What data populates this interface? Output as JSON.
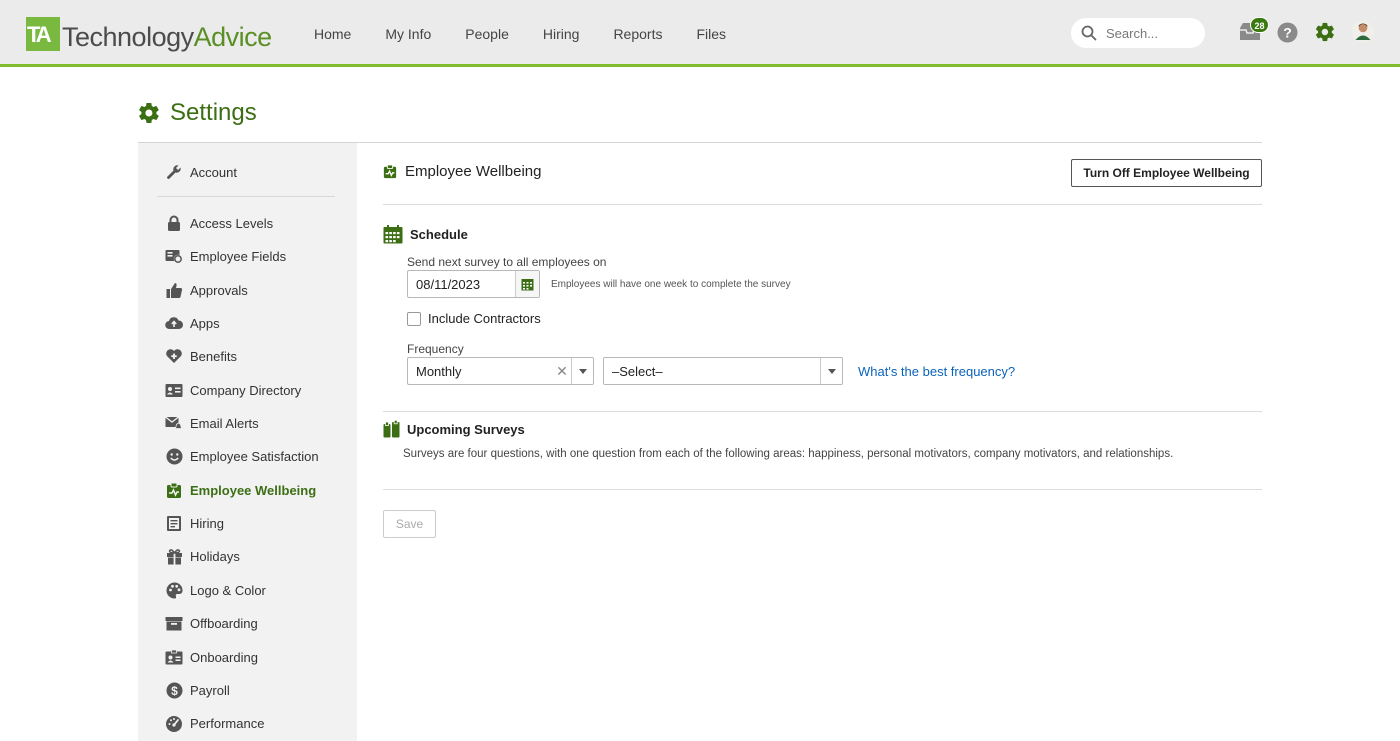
{
  "app": {
    "logo_mark": "TA",
    "logo_text_1": "Technology",
    "logo_text_2": "Advice"
  },
  "nav": {
    "items": [
      {
        "label": "Home"
      },
      {
        "label": "My Info"
      },
      {
        "label": "People"
      },
      {
        "label": "Hiring"
      },
      {
        "label": "Reports"
      },
      {
        "label": "Files"
      }
    ]
  },
  "header": {
    "search_placeholder": "Search...",
    "inbox_count": "28",
    "icons": [
      "inbox-icon",
      "help-icon",
      "settings-gear-icon",
      "user-avatar"
    ]
  },
  "page": {
    "title": "Settings"
  },
  "sidebar": {
    "items": [
      {
        "label": "Account",
        "icon": "wrench-icon"
      },
      {
        "label": "Access Levels",
        "icon": "lock-icon"
      },
      {
        "label": "Employee Fields",
        "icon": "id-card-icon"
      },
      {
        "label": "Approvals",
        "icon": "thumbs-up-icon"
      },
      {
        "label": "Apps",
        "icon": "cloud-upload-icon"
      },
      {
        "label": "Benefits",
        "icon": "heart-plus-icon"
      },
      {
        "label": "Company Directory",
        "icon": "address-book-icon"
      },
      {
        "label": "Email Alerts",
        "icon": "mail-alert-icon"
      },
      {
        "label": "Employee Satisfaction",
        "icon": "smiley-icon"
      },
      {
        "label": "Employee Wellbeing",
        "icon": "wellbeing-icon",
        "active": true
      },
      {
        "label": "Hiring",
        "icon": "clipboard-icon"
      },
      {
        "label": "Holidays",
        "icon": "gift-icon"
      },
      {
        "label": "Logo & Color",
        "icon": "palette-icon"
      },
      {
        "label": "Offboarding",
        "icon": "box-icon"
      },
      {
        "label": "Onboarding",
        "icon": "badge-card-icon"
      },
      {
        "label": "Payroll",
        "icon": "dollar-icon"
      },
      {
        "label": "Performance",
        "icon": "gauge-icon"
      }
    ]
  },
  "main": {
    "heading": "Employee Wellbeing",
    "turn_off_label": "Turn Off Employee Wellbeing",
    "schedule": {
      "heading": "Schedule",
      "send_label": "Send next survey to all employees on",
      "date_value": "08/11/2023",
      "hint": "Employees will have one week to complete the survey",
      "include_contractors_label": "Include Contractors",
      "include_contractors_checked": false,
      "frequency_label": "Frequency",
      "frequency_value": "Monthly",
      "second_select_value": "–Select–",
      "frequency_link": "What's the best frequency?"
    },
    "upcoming": {
      "heading": "Upcoming Surveys",
      "description": "Surveys are four questions, with one question from each of the following areas: happiness, personal motivators, company motivators, and relationships."
    },
    "save_label": "Save"
  },
  "colors": {
    "brand_green": "#3c6f14",
    "accent_bar": "#7fbd2e",
    "link_blue": "#0b63b8"
  }
}
